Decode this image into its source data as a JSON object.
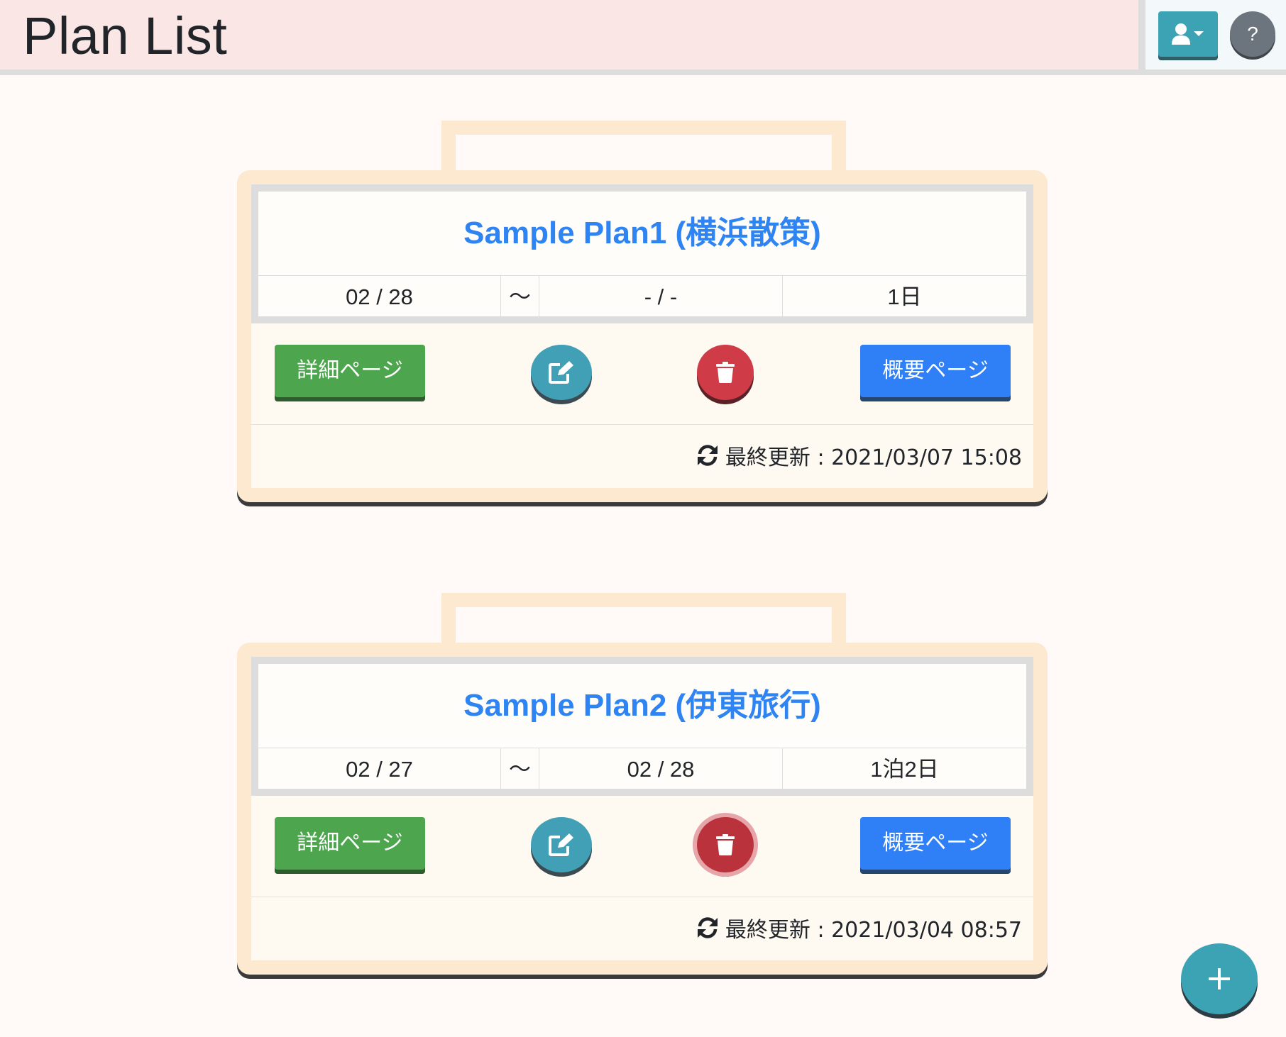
{
  "header": {
    "title": "Plan List",
    "help_label": "?"
  },
  "plans": [
    {
      "title": "Sample Plan1 (横浜散策)",
      "start": "02 / 28",
      "separator": "〜",
      "end": "- / -",
      "duration": "1日",
      "detail_label": "詳細ページ",
      "summary_label": "概要ページ",
      "updated": "最終更新 : 2021/03/07 15:08"
    },
    {
      "title": "Sample Plan2 (伊東旅行)",
      "start": "02 / 27",
      "separator": "〜",
      "end": "02 / 28",
      "duration": "1泊2日",
      "detail_label": "詳細ページ",
      "summary_label": "概要ページ",
      "updated": "最終更新 : 2021/03/04 08:57"
    }
  ],
  "icons": {
    "user": "user-icon",
    "caret": "caret-down-icon",
    "edit": "edit-icon",
    "delete": "trash-icon",
    "refresh": "refresh-icon",
    "add": "plus-icon"
  },
  "colors": {
    "header_bg": "#fae6e4",
    "plan_frame": "#fde9d0",
    "title_link": "#2f84f4",
    "detail_button": "#4da64d",
    "summary_button": "#2f7ff7",
    "edit_button": "#42a0b6",
    "delete_button": "#cf3b46",
    "fab": "#3ba3b4"
  }
}
